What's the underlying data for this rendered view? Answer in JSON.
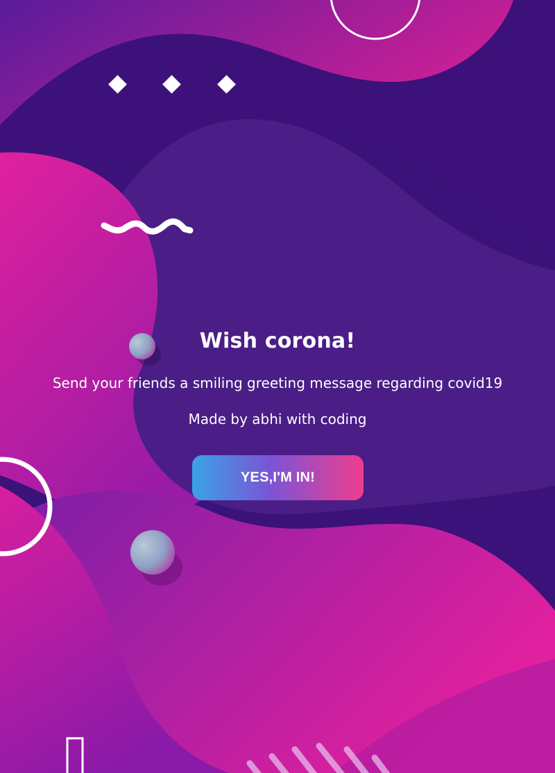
{
  "hero": {
    "title": "Wish corona!",
    "subtitle": "Send your friends a smiling greeting message regarding covid19",
    "credit": "Made by abhi with coding",
    "cta_label": "YES,I'M IN!"
  },
  "colors": {
    "background": "#3b1279",
    "magenta": "#d71a9c",
    "purple": "#55208e",
    "button_start": "#3aa3e6",
    "button_end": "#ee3d8e"
  }
}
